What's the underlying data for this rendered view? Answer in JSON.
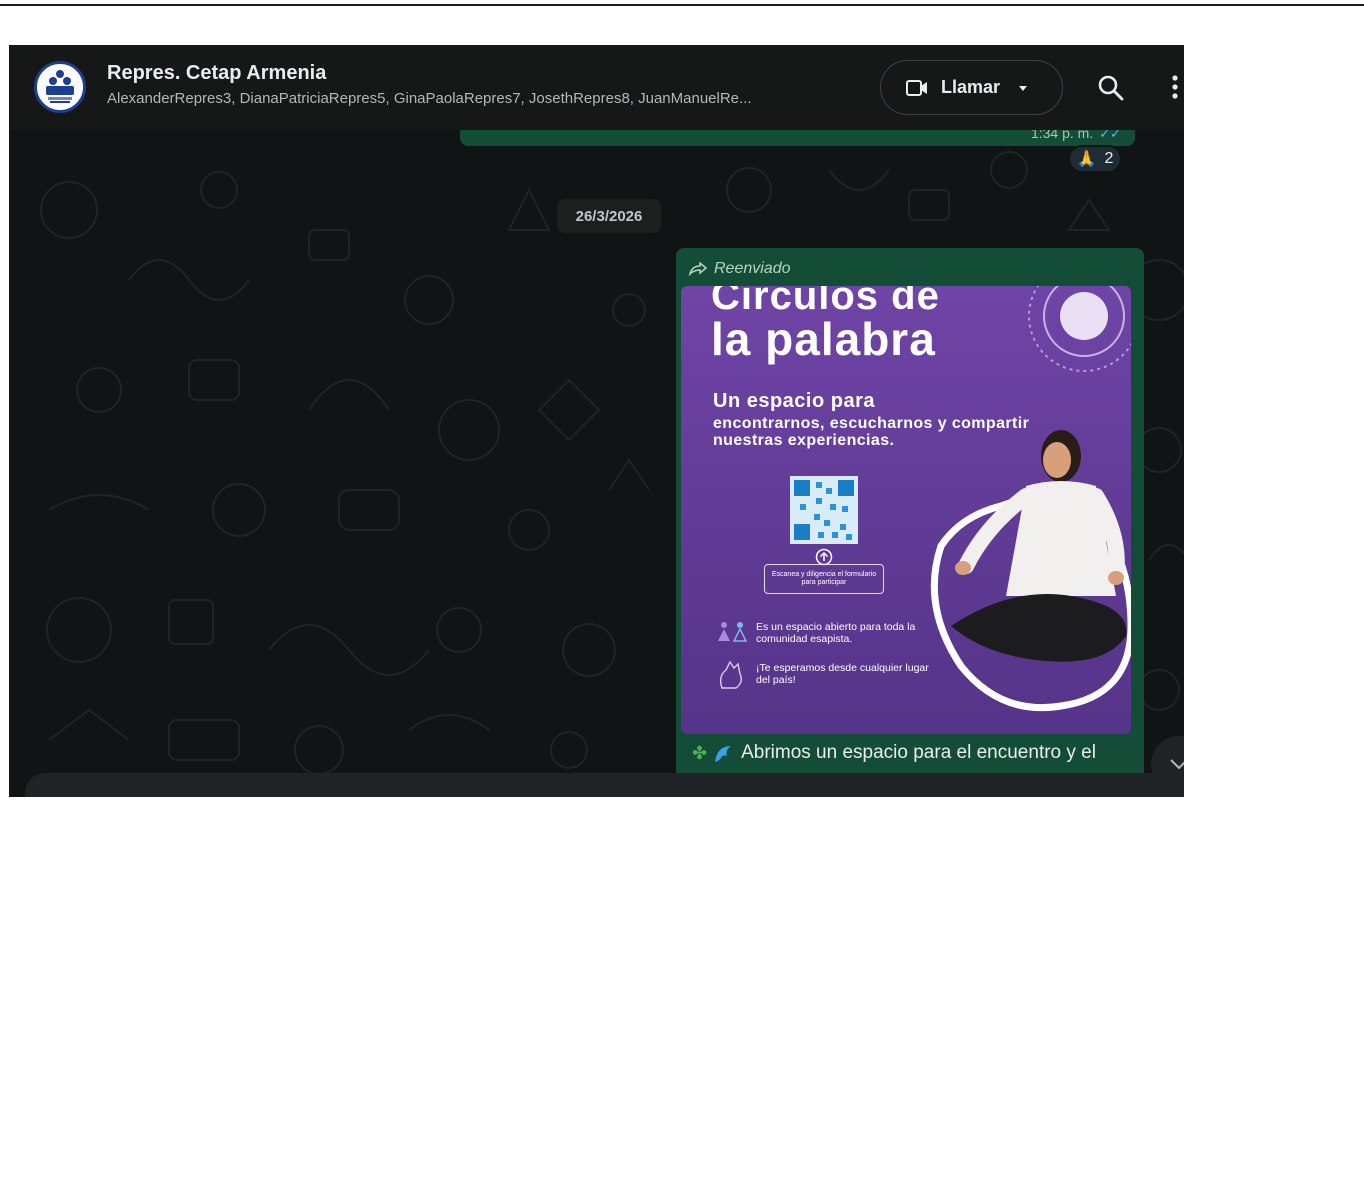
{
  "header": {
    "title": "Repres. Cetap Armenia",
    "members": "AlexanderRepres3, DianaPatriciaRepres5, GinaPaolaRepres7, JosethRepres8, JuanManuelRe...",
    "call_label": "Llamar",
    "icons": [
      "group-avatar",
      "video-camera-icon",
      "caret-down-icon",
      "search-icon",
      "more-vertical-icon"
    ]
  },
  "chat": {
    "previous_message": {
      "time": "1:34 p. m.",
      "reaction_emoji": "🙏",
      "reaction_count": "2"
    },
    "date_divider": "26/3/2026",
    "forwarded_message": {
      "forwarded_label": "Reenviado",
      "poster": {
        "title_line1": "Círculos de",
        "title_line2": "la palabra",
        "subtitle": "Un espacio para",
        "subtitle_detail": "encontrarnos, escucharnos y compartir nuestras experiencias.",
        "scan_text": "Escanea y diligencia el formulario para participar",
        "info_open": "Es un espacio abierto para toda la comunidad esapista.",
        "info_welcome": "¡Te esperamos desde cualquier lugar del país!"
      },
      "caption": "Abrimos un espacio para el encuentro y el"
    }
  },
  "colors": {
    "chat_background": "#111415",
    "header_background": "#161717",
    "outgoing_bubble": "#144d37",
    "poster_purple": "#6f44a6"
  }
}
